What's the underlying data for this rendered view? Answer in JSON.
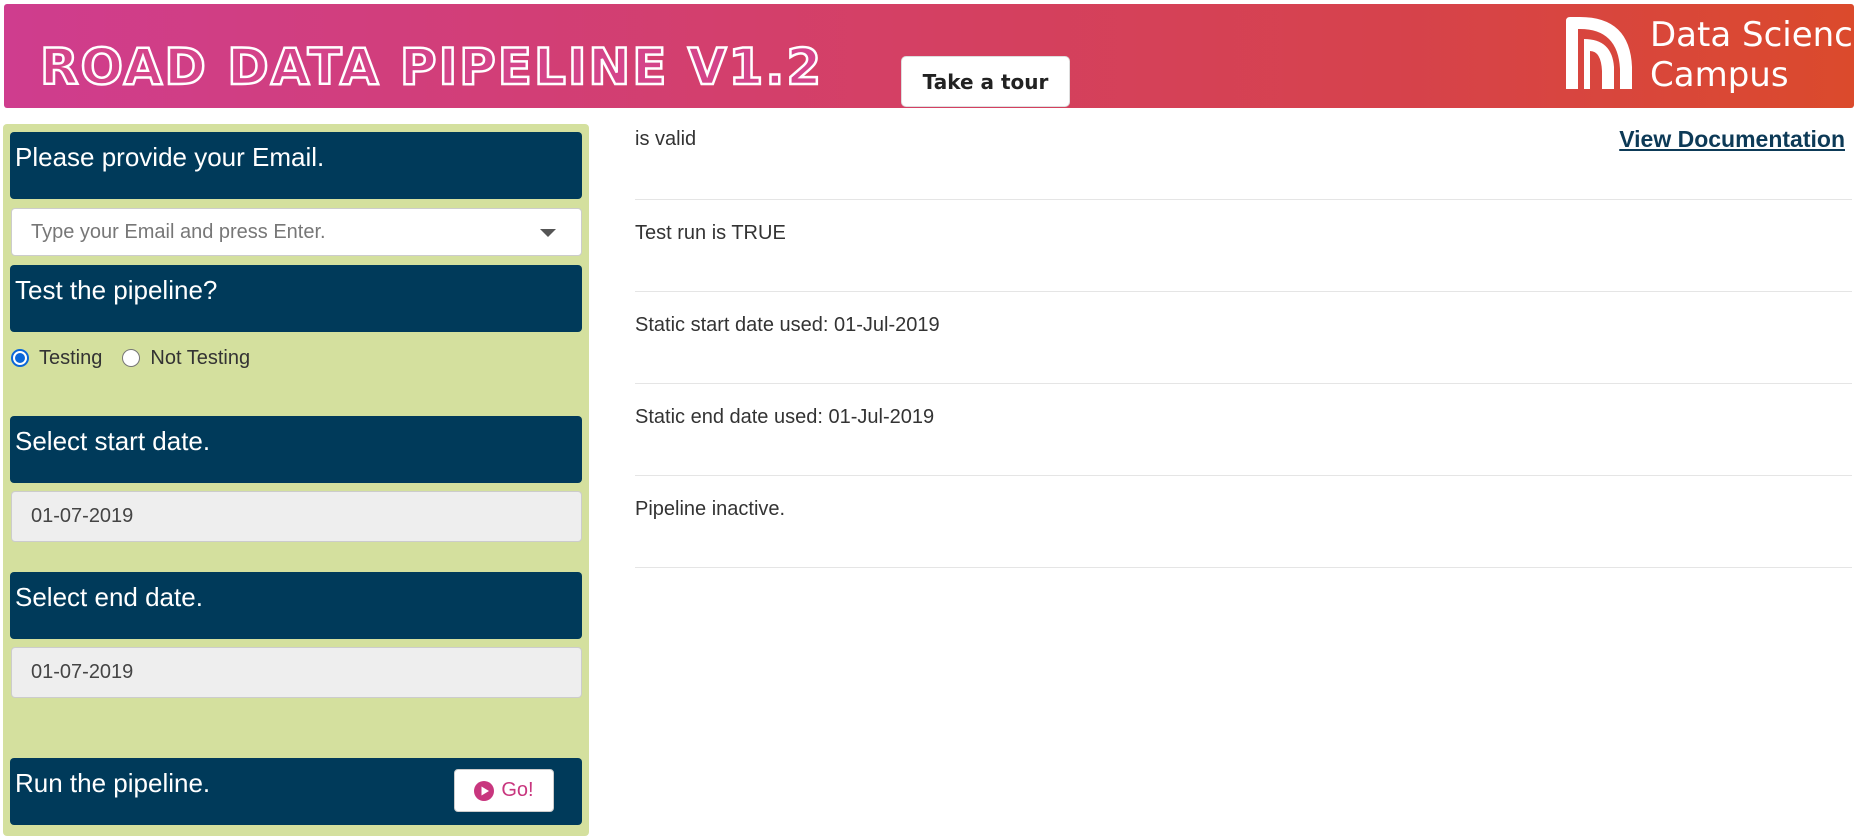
{
  "header": {
    "title": "ROAD DATA PIPELINE V1.2",
    "tour_button": "Take a tour",
    "brand": {
      "line1": "Data Science",
      "line2": "Campus",
      "logo_icon": "dsc-logo-icon"
    }
  },
  "sidebar": {
    "email": {
      "heading": "Please provide your Email.",
      "placeholder": "Type your Email and press Enter."
    },
    "test": {
      "heading": "Test the pipeline?",
      "options": [
        {
          "label": "Testing",
          "selected": true
        },
        {
          "label": "Not Testing",
          "selected": false
        }
      ]
    },
    "start_date": {
      "heading": "Select start date.",
      "value": "01-07-2019"
    },
    "end_date": {
      "heading": "Select end date.",
      "value": "01-07-2019"
    },
    "run": {
      "heading": "Run the pipeline.",
      "button": "Go!",
      "icon": "play-circle-icon"
    }
  },
  "main": {
    "doc_link": "View Documentation",
    "status_lines": [
      "is valid",
      "Test run is TRUE",
      "Static start date used: 01-Jul-2019",
      "Static end date used: 01-Jul-2019",
      "Pipeline inactive."
    ]
  },
  "colors": {
    "header_gradient_start": "#cf3d8e",
    "header_gradient_end": "#db4a2c",
    "sidebar_bg": "#d4e09e",
    "panel_head_bg": "#003a5a",
    "accent_pink": "#c8367e",
    "link": "#0d3a57"
  }
}
